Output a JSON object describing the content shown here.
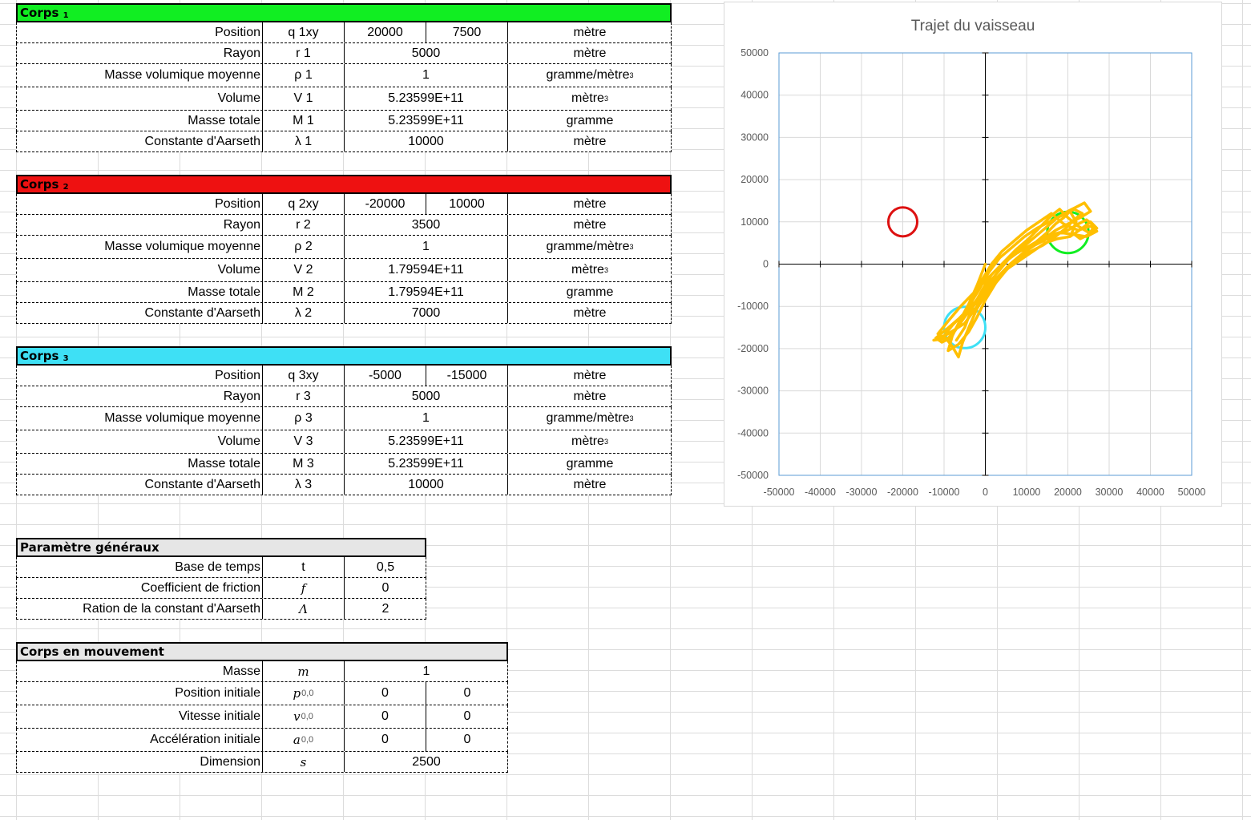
{
  "corps": [
    {
      "title": "Corps",
      "index": "1",
      "color": "#11ee22",
      "rows": [
        {
          "label": "Position",
          "sym": "q 1xy",
          "v1": "20000",
          "v2": "7500",
          "unit": "mètre",
          "unit_sup": ""
        },
        {
          "label": "Rayon",
          "sym": "r 1",
          "v": "5000",
          "unit": "mètre",
          "unit_sup": ""
        },
        {
          "label": "Masse volumique moyenne",
          "sym": "ρ 1",
          "v": "1",
          "unit": "gramme/mètre",
          "unit_sup": "3"
        },
        {
          "label": "Volume",
          "sym": "V 1",
          "v": "5.23599E+11",
          "unit": "mètre",
          "unit_sup": "3"
        },
        {
          "label": "Masse totale",
          "sym": "M 1",
          "v": "5.23599E+11",
          "unit": "gramme",
          "unit_sup": ""
        },
        {
          "label": "Constante d'Aarseth",
          "sym": "λ 1",
          "v": "10000",
          "unit": "mètre",
          "unit_sup": ""
        }
      ]
    },
    {
      "title": "Corps",
      "index": "2",
      "color": "#ee1111",
      "rows": [
        {
          "label": "Position",
          "sym": "q 2xy",
          "v1": "-20000",
          "v2": "10000",
          "unit": "mètre",
          "unit_sup": ""
        },
        {
          "label": "Rayon",
          "sym": "r 2",
          "v": "3500",
          "unit": "mètre",
          "unit_sup": ""
        },
        {
          "label": "Masse volumique moyenne",
          "sym": "ρ 2",
          "v": "1",
          "unit": "gramme/mètre",
          "unit_sup": "3"
        },
        {
          "label": "Volume",
          "sym": "V 2",
          "v": "1.79594E+11",
          "unit": "mètre",
          "unit_sup": "3"
        },
        {
          "label": "Masse totale",
          "sym": "M 2",
          "v": "1.79594E+11",
          "unit": "gramme",
          "unit_sup": ""
        },
        {
          "label": "Constante d'Aarseth",
          "sym": "λ 2",
          "v": "7000",
          "unit": "mètre",
          "unit_sup": ""
        }
      ]
    },
    {
      "title": "Corps",
      "index": "3",
      "color": "#3ee0f5",
      "rows": [
        {
          "label": "Position",
          "sym": "q 3xy",
          "v1": "-5000",
          "v2": "-15000",
          "unit": "mètre",
          "unit_sup": ""
        },
        {
          "label": "Rayon",
          "sym": "r 3",
          "v": "5000",
          "unit": "mètre",
          "unit_sup": ""
        },
        {
          "label": "Masse volumique moyenne",
          "sym": "ρ 3",
          "v": "1",
          "unit": "gramme/mètre",
          "unit_sup": "3"
        },
        {
          "label": "Volume",
          "sym": "V 3",
          "v": "5.23599E+11",
          "unit": "mètre",
          "unit_sup": "3"
        },
        {
          "label": "Masse totale",
          "sym": "M 3",
          "v": "5.23599E+11",
          "unit": "gramme",
          "unit_sup": ""
        },
        {
          "label": "Constante d'Aarseth",
          "sym": "λ 3",
          "v": "10000",
          "unit": "mètre",
          "unit_sup": ""
        }
      ]
    }
  ],
  "params": {
    "title": "Paramètre généraux",
    "color": "#e6e6e6",
    "rows": [
      {
        "label": "Base de temps",
        "sym": "t",
        "v": "0,5"
      },
      {
        "label": "Coefficient de friction",
        "sym": "f",
        "v": "0"
      },
      {
        "label": "Ration de la constant d'Aarseth",
        "sym": "Λ",
        "v": "2"
      }
    ]
  },
  "mouvement": {
    "title": "Corps en mouvement",
    "color": "#e6e6e6",
    "rows": [
      {
        "label": "Masse",
        "sym": "m",
        "sub": "",
        "v": "1"
      },
      {
        "label": "Position initiale",
        "sym": "p",
        "sub": "0,0",
        "v1": "0",
        "v2": "0"
      },
      {
        "label": "Vitesse initiale",
        "sym": "v",
        "sub": "0,0",
        "v1": "0",
        "v2": "0"
      },
      {
        "label": "Accélération initiale",
        "sym": "a",
        "sub": "0,0",
        "v1": "0",
        "v2": "0"
      },
      {
        "label": "Dimension",
        "sym": "s",
        "sub": "",
        "v": "2500"
      }
    ]
  },
  "chart_data": {
    "type": "scatter",
    "title": "Trajet du vaisseau",
    "xlabel": "",
    "ylabel": "",
    "xlim": [
      -50000,
      50000
    ],
    "ylim": [
      -50000,
      50000
    ],
    "xticks": [
      -50000,
      -40000,
      -30000,
      -20000,
      -10000,
      0,
      10000,
      20000,
      30000,
      40000,
      50000
    ],
    "yticks": [
      50000,
      40000,
      30000,
      20000,
      10000,
      0,
      -10000,
      -20000,
      -30000,
      -40000,
      -50000
    ],
    "grid": true,
    "bodies": [
      {
        "x": 20000,
        "y": 7500,
        "r": 5000,
        "color": "#11ee22"
      },
      {
        "x": -20000,
        "y": 10000,
        "r": 3500,
        "color": "#dd1111"
      },
      {
        "x": -5000,
        "y": -15000,
        "r": 5000,
        "color": "#3ee0f5"
      }
    ],
    "trajectory_color": "#ffbf00",
    "trajectory": [
      [
        0,
        0
      ],
      [
        -2000,
        -5000
      ],
      [
        -4500,
        -10500
      ],
      [
        -7000,
        -15000
      ],
      [
        -8500,
        -17500
      ],
      [
        -11000,
        -17800
      ],
      [
        -12500,
        -18000
      ],
      [
        -9000,
        -16500
      ],
      [
        -5000,
        -14000
      ],
      [
        -2000,
        -10000
      ],
      [
        0,
        -6000
      ],
      [
        3000,
        -3000
      ],
      [
        6000,
        0
      ],
      [
        9000,
        2500
      ],
      [
        12000,
        4500
      ],
      [
        15000,
        6000
      ],
      [
        17500,
        7200
      ],
      [
        20000,
        8000
      ],
      [
        22500,
        9500
      ],
      [
        24500,
        10500
      ],
      [
        26500,
        9000
      ],
      [
        25000,
        7000
      ],
      [
        23000,
        6000
      ],
      [
        21000,
        7500
      ],
      [
        22000,
        10000
      ],
      [
        20500,
        12500
      ],
      [
        19000,
        11000
      ],
      [
        17000,
        9500
      ],
      [
        15000,
        7500
      ],
      [
        12000,
        5000
      ],
      [
        9000,
        2500
      ],
      [
        6000,
        0
      ],
      [
        3000,
        -3000
      ],
      [
        500,
        -6500
      ],
      [
        -2000,
        -10500
      ],
      [
        -4000,
        -15000
      ],
      [
        -5500,
        -18500
      ],
      [
        -6500,
        -22000
      ],
      [
        -8000,
        -19500
      ],
      [
        -10000,
        -17000
      ],
      [
        -8000,
        -14500
      ],
      [
        -5500,
        -12000
      ],
      [
        -2500,
        -9000
      ],
      [
        500,
        -5500
      ],
      [
        4000,
        -2500
      ],
      [
        7000,
        500
      ],
      [
        10000,
        3500
      ],
      [
        13500,
        5500
      ],
      [
        17000,
        8000
      ],
      [
        20000,
        9500
      ],
      [
        23000,
        11000
      ],
      [
        25500,
        12500
      ],
      [
        24000,
        14500
      ],
      [
        22000,
        13500
      ],
      [
        20000,
        12500
      ],
      [
        17500,
        11000
      ],
      [
        14500,
        8500
      ],
      [
        11500,
        6000
      ],
      [
        8500,
        3500
      ],
      [
        5500,
        1000
      ],
      [
        2500,
        -2500
      ],
      [
        0,
        -5500
      ],
      [
        -2500,
        -9000
      ],
      [
        -5000,
        -12500
      ],
      [
        -7500,
        -16000
      ],
      [
        -9500,
        -18000
      ],
      [
        -11500,
        -16500
      ],
      [
        -9000,
        -13500
      ],
      [
        -6000,
        -10000
      ],
      [
        -3000,
        -7000
      ],
      [
        500,
        -3500
      ],
      [
        4000,
        0
      ],
      [
        7500,
        2500
      ],
      [
        11000,
        4500
      ],
      [
        14500,
        6500
      ],
      [
        18000,
        7500
      ],
      [
        21500,
        7000
      ],
      [
        24500,
        6500
      ],
      [
        27000,
        7800
      ],
      [
        25500,
        9000
      ],
      [
        22500,
        8000
      ],
      [
        19000,
        9500
      ],
      [
        16000,
        12000
      ],
      [
        13000,
        10000
      ],
      [
        10000,
        8000
      ],
      [
        7000,
        5500
      ],
      [
        4000,
        3000
      ],
      [
        1500,
        0
      ],
      [
        -1000,
        -4000
      ],
      [
        -3500,
        -8500
      ],
      [
        -6000,
        -13000
      ],
      [
        -8000,
        -17000
      ],
      [
        -9000,
        -20500
      ],
      [
        -6500,
        -19000
      ],
      [
        -4000,
        -16000
      ],
      [
        -2000,
        -12500
      ],
      [
        0,
        -8500
      ],
      [
        2500,
        -4500
      ],
      [
        5000,
        -1500
      ],
      [
        8000,
        1500
      ],
      [
        11000,
        3000
      ],
      [
        14000,
        4500
      ],
      [
        17000,
        6500
      ],
      [
        19500,
        8500
      ],
      [
        21500,
        10500
      ],
      [
        23500,
        12000
      ],
      [
        21500,
        13000
      ],
      [
        18500,
        11500
      ],
      [
        15500,
        10000
      ],
      [
        12500,
        8500
      ],
      [
        9500,
        6500
      ],
      [
        6500,
        4000
      ],
      [
        3500,
        1500
      ],
      [
        800,
        -2000
      ],
      [
        -1500,
        -6000
      ],
      [
        -4000,
        -10000
      ],
      [
        -6500,
        -14500
      ],
      [
        -8500,
        -17500
      ],
      [
        -10500,
        -18500
      ],
      [
        -12000,
        -17500
      ],
      [
        -9500,
        -15500
      ],
      [
        -6500,
        -13000
      ],
      [
        -3500,
        -10500
      ],
      [
        -500,
        -7500
      ],
      [
        2500,
        -4000
      ],
      [
        5500,
        -1000
      ],
      [
        8500,
        1000
      ],
      [
        11500,
        3000
      ],
      [
        14500,
        5000
      ],
      [
        17500,
        6000
      ],
      [
        20500,
        6500
      ],
      [
        23500,
        8500
      ],
      [
        25500,
        10000
      ],
      [
        27000,
        8500
      ],
      [
        25000,
        7500
      ],
      [
        22500,
        9000
      ],
      [
        20000,
        11000
      ],
      [
        18000,
        13000
      ],
      [
        16000,
        11500
      ],
      [
        13500,
        9000
      ],
      [
        10500,
        6000
      ],
      [
        7500,
        3500
      ],
      [
        4500,
        500
      ],
      [
        1500,
        -2500
      ],
      [
        -1000,
        -6500
      ],
      [
        -3500,
        -11000
      ],
      [
        -5000,
        -15000
      ],
      [
        -7000,
        -18000
      ]
    ]
  }
}
